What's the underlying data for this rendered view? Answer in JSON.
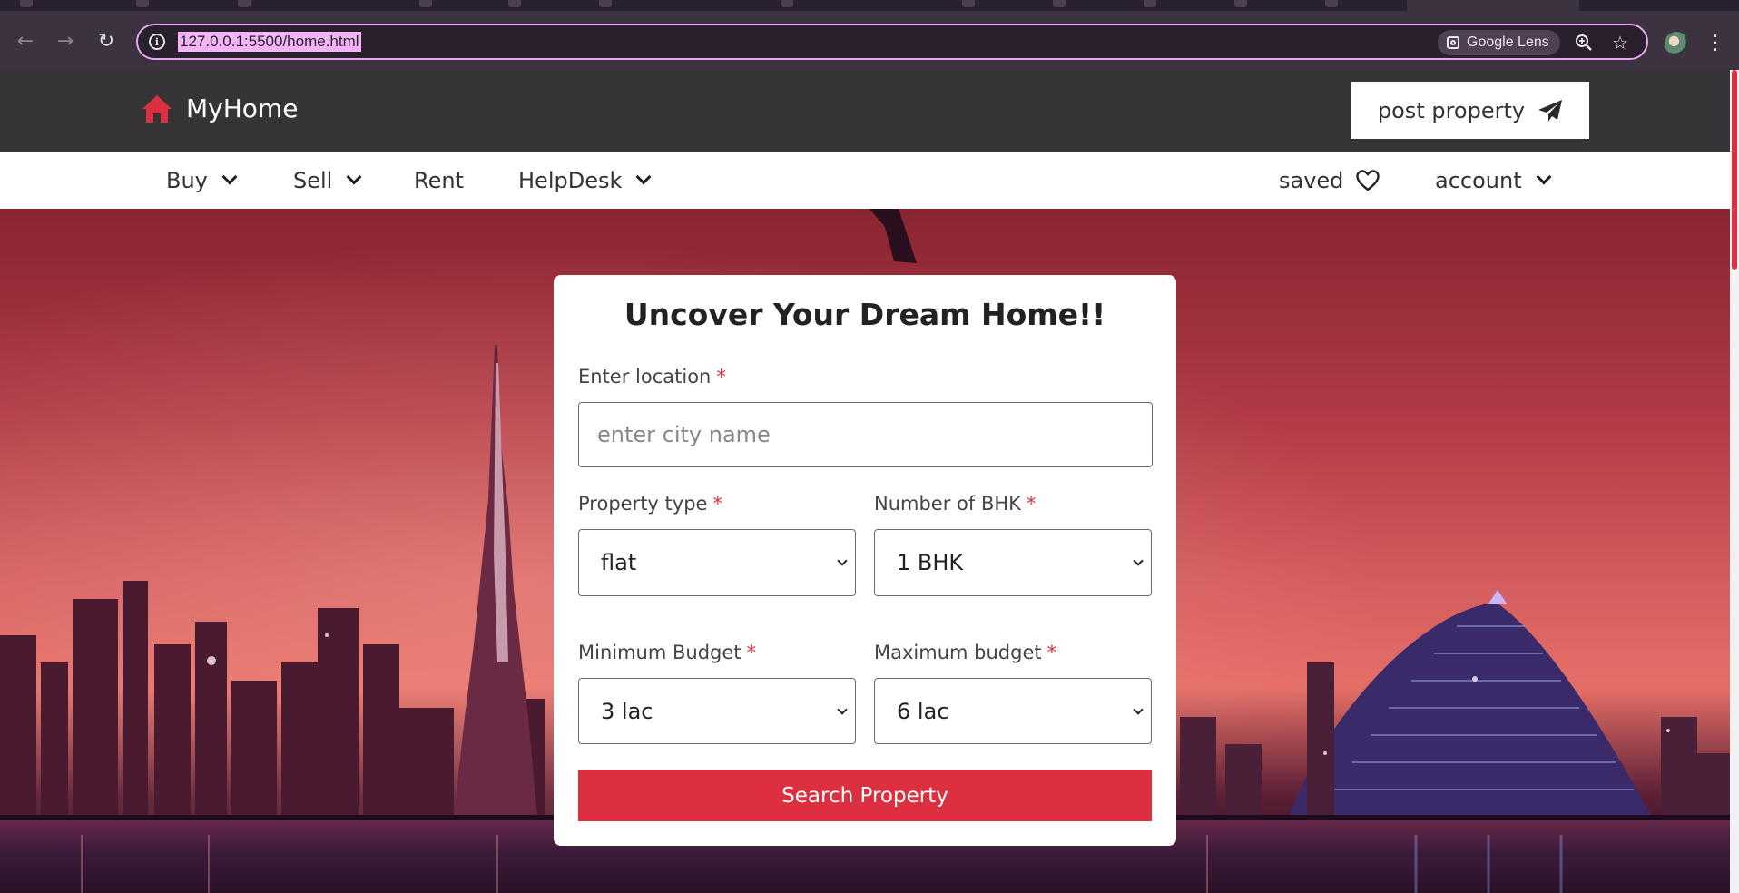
{
  "browser": {
    "url": "127.0.0.1:5500/home.html",
    "lens_label": "Google Lens",
    "icons": [
      "back-icon",
      "forward-icon",
      "reload-icon",
      "site-info-icon",
      "google-lens-icon",
      "zoom-icon",
      "bookmark-star-icon",
      "profile-avatar",
      "kebab-menu-icon"
    ]
  },
  "header": {
    "brand": "MyHome",
    "post_button": "post property",
    "brand_color": "#dc2f3f"
  },
  "nav": {
    "buy": "Buy",
    "sell": "Sell",
    "rent": "Rent",
    "helpdesk": "HelpDesk",
    "saved": "saved",
    "account": "account"
  },
  "search_card": {
    "title": "Uncover Your Dream Home!!",
    "location_label": "Enter location",
    "location_placeholder": "enter city name",
    "property_type_label": "Property type",
    "property_type_value": "flat",
    "bhk_label": "Number of BHK",
    "bhk_value": "1 BHK",
    "min_budget_label": "Minimum Budget",
    "min_budget_value": "3 lac",
    "max_budget_label": "Maximum budget",
    "max_budget_value": "6 lac",
    "required_mark": "*",
    "submit": "Search Property"
  },
  "colors": {
    "accent": "#dc2f3f",
    "header_bg": "#363436",
    "omnibox_border": "#e7a9ef"
  }
}
